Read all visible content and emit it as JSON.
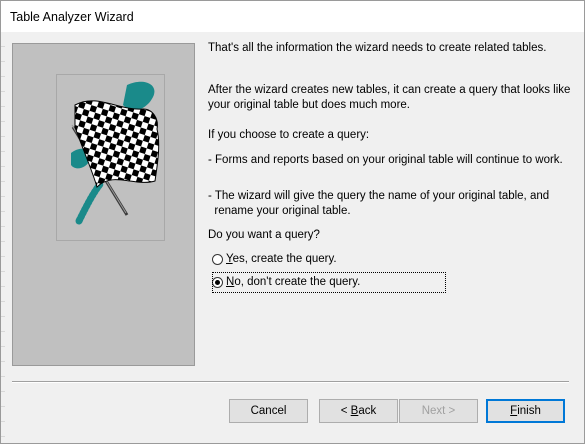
{
  "window": {
    "title": "Table Analyzer Wizard"
  },
  "content": {
    "intro": "That's all the information the wizard needs to create related tables.",
    "para_line1": "After the wizard creates new tables, it can create a query that looks like",
    "para_line2": "your original table but does much more.",
    "if_choose": "If you choose to create a query:",
    "bullet1": "- Forms and reports based on your original table will continue to work.",
    "bullet2_line1": "- The wizard will give the query the name of your original table, and",
    "bullet2_line2": "  rename your original table.",
    "question": "Do you want a query?"
  },
  "options": {
    "yes": {
      "mnemonic": "Y",
      "rest": "es, create the query.",
      "selected": false
    },
    "no": {
      "mnemonic": "N",
      "rest": "o, don't create the query.",
      "selected": true
    }
  },
  "buttons": {
    "cancel": "Cancel",
    "back": {
      "prefix": "< ",
      "mnemonic": "B",
      "rest": "ack"
    },
    "next": "Next >",
    "finish": {
      "mnemonic": "F",
      "rest": "inish"
    }
  },
  "colors": {
    "accent_teal": "#1a8a8a",
    "focus_blue": "#0078d7"
  },
  "icons": [
    "checkered-flag-icon"
  ]
}
